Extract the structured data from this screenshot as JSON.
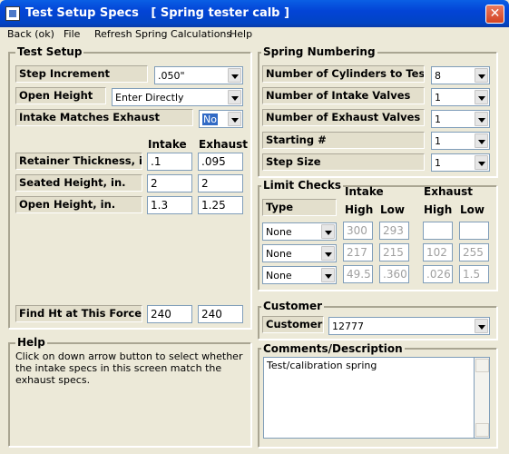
{
  "window": {
    "title": "Test Setup Specs   [ Spring tester calb ]",
    "close_glyph": "✕"
  },
  "menu": [
    "Back (ok)",
    "File",
    "Refresh Spring Calculations",
    "Help"
  ],
  "test_setup": {
    "title": "Test Setup",
    "step_increment": {
      "label": "Step Increment",
      "value": ".050\""
    },
    "open_height": {
      "label": "Open Height",
      "value": "Enter Directly"
    },
    "intake_matches_exhaust": {
      "label": "Intake Matches Exhaust",
      "value": "No"
    },
    "col_intake": "Intake",
    "col_exhaust": "Exhaust",
    "rows": [
      {
        "label": "Retainer Thickness, in.",
        "intake": ".1",
        "exhaust": ".095"
      },
      {
        "label": "Seated Height, in.",
        "intake": "2",
        "exhaust": "2"
      },
      {
        "label": "Open Height, in.",
        "intake": "1.3",
        "exhaust": "1.25"
      }
    ],
    "find_ht": {
      "label": "Find Ht at This Force",
      "intake": "240",
      "exhaust": "240"
    }
  },
  "help": {
    "title": "Help",
    "text": "Click on down arrow button to select whether the intake specs in this screen match the exhaust specs."
  },
  "spring_numbering": {
    "title": "Spring Numbering",
    "rows": [
      {
        "label": "Number of Cylinders to Test",
        "value": "8"
      },
      {
        "label": "Number of Intake Valves",
        "value": "1"
      },
      {
        "label": "Number of Exhaust Valves",
        "value": "1"
      },
      {
        "label": "Starting #",
        "value": "1"
      },
      {
        "label": "Step Size",
        "value": "1"
      }
    ]
  },
  "limit_checks": {
    "title": "Limit Checks",
    "type_label": "Type",
    "intake_label": "Intake",
    "exhaust_label": "Exhaust",
    "high": "High",
    "low": "Low",
    "rows": [
      {
        "type": "None",
        "intake_high": "300",
        "intake_low": "293",
        "exhaust_high": "",
        "exhaust_low": ""
      },
      {
        "type": "None",
        "intake_high": "217",
        "intake_low": "215",
        "exhaust_high": "102",
        "exhaust_low": "255"
      },
      {
        "type": "None",
        "intake_high": "49.5",
        "intake_low": ".360",
        "exhaust_high": ".026",
        "exhaust_low": "1.5"
      }
    ]
  },
  "customer": {
    "title": "Customer",
    "label": "Customer",
    "value": "12777"
  },
  "comments": {
    "title": "Comments/Description",
    "value": "Test/calibration spring"
  }
}
